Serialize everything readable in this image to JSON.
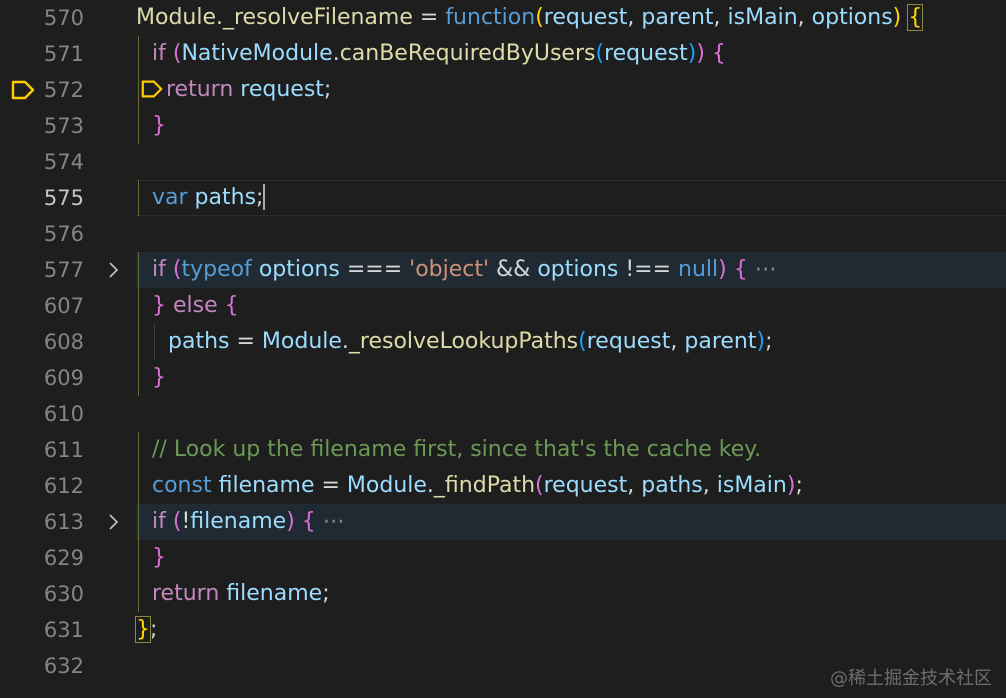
{
  "editor": {
    "lines": [
      {
        "num": "570",
        "tokens": [
          [
            "fn",
            "Module._resolveFilename"
          ],
          [
            "op",
            " = "
          ],
          [
            "kw2",
            "function"
          ],
          [
            "b1",
            "("
          ],
          [
            "var",
            "request"
          ],
          [
            "op",
            ", "
          ],
          [
            "var",
            "parent"
          ],
          [
            "op",
            ", "
          ],
          [
            "var",
            "isMain"
          ],
          [
            "op",
            ", "
          ],
          [
            "var",
            "options"
          ],
          [
            "b1",
            ")"
          ],
          [
            "op",
            " "
          ],
          [
            "b1",
            "{"
          ]
        ]
      },
      {
        "num": "571",
        "tokens": [
          [
            "kw",
            "if"
          ],
          [
            "op",
            " "
          ],
          [
            "b2",
            "("
          ],
          [
            "var",
            "NativeModule"
          ],
          [
            "op",
            "."
          ],
          [
            "fn",
            "canBeRequiredByUsers"
          ],
          [
            "b3",
            "("
          ],
          [
            "var",
            "request"
          ],
          [
            "b3",
            ")"
          ],
          [
            "b2",
            ")"
          ],
          [
            "op",
            " "
          ],
          [
            "b2",
            "{"
          ]
        ]
      },
      {
        "num": "572",
        "tokens": [
          [
            "kw",
            "return"
          ],
          [
            "op",
            " "
          ],
          [
            "var",
            "request"
          ],
          [
            "op",
            ";"
          ]
        ]
      },
      {
        "num": "573",
        "tokens": [
          [
            "b2",
            "}"
          ]
        ]
      },
      {
        "num": "574",
        "tokens": []
      },
      {
        "num": "575",
        "tokens": [
          [
            "kw2",
            "var"
          ],
          [
            "op",
            " "
          ],
          [
            "var",
            "paths"
          ],
          [
            "op",
            ";"
          ]
        ]
      },
      {
        "num": "576",
        "tokens": []
      },
      {
        "num": "577",
        "tokens": [
          [
            "kw",
            "if"
          ],
          [
            "op",
            " "
          ],
          [
            "b2",
            "("
          ],
          [
            "kw2",
            "typeof"
          ],
          [
            "op",
            " "
          ],
          [
            "var",
            "options"
          ],
          [
            "op",
            " === "
          ],
          [
            "str",
            "'object'"
          ],
          [
            "op",
            " && "
          ],
          [
            "var",
            "options"
          ],
          [
            "op",
            " !== "
          ],
          [
            "kw2",
            "null"
          ],
          [
            "b2",
            ")"
          ],
          [
            "op",
            " "
          ],
          [
            "b2",
            "{"
          ],
          [
            "ell",
            " ⋯"
          ]
        ]
      },
      {
        "num": "607",
        "tokens": [
          [
            "b2",
            "}"
          ],
          [
            "op",
            " "
          ],
          [
            "kw",
            "else"
          ],
          [
            "op",
            " "
          ],
          [
            "b2",
            "{"
          ]
        ]
      },
      {
        "num": "608",
        "tokens": [
          [
            "var",
            "paths"
          ],
          [
            "op",
            " = "
          ],
          [
            "var",
            "Module"
          ],
          [
            "op",
            "."
          ],
          [
            "fn",
            "_resolveLookupPaths"
          ],
          [
            "b3",
            "("
          ],
          [
            "var",
            "request"
          ],
          [
            "op",
            ", "
          ],
          [
            "var",
            "parent"
          ],
          [
            "b3",
            ")"
          ],
          [
            "op",
            ";"
          ]
        ]
      },
      {
        "num": "609",
        "tokens": [
          [
            "b2",
            "}"
          ]
        ]
      },
      {
        "num": "610",
        "tokens": []
      },
      {
        "num": "611",
        "tokens": [
          [
            "cm",
            "// Look up the filename first, since that's the cache key."
          ]
        ]
      },
      {
        "num": "612",
        "tokens": [
          [
            "kw2",
            "const"
          ],
          [
            "op",
            " "
          ],
          [
            "var",
            "filename"
          ],
          [
            "op",
            " = "
          ],
          [
            "var",
            "Module"
          ],
          [
            "op",
            "."
          ],
          [
            "fn",
            "_findPath"
          ],
          [
            "b2",
            "("
          ],
          [
            "var",
            "request"
          ],
          [
            "op",
            ", "
          ],
          [
            "var",
            "paths"
          ],
          [
            "op",
            ", "
          ],
          [
            "var",
            "isMain"
          ],
          [
            "b2",
            ")"
          ],
          [
            "op",
            ";"
          ]
        ]
      },
      {
        "num": "613",
        "tokens": [
          [
            "kw",
            "if"
          ],
          [
            "op",
            " "
          ],
          [
            "b2",
            "("
          ],
          [
            "op",
            "!"
          ],
          [
            "var",
            "filename"
          ],
          [
            "b2",
            ")"
          ],
          [
            "op",
            " "
          ],
          [
            "b2",
            "{"
          ],
          [
            "ell",
            " ⋯"
          ]
        ]
      },
      {
        "num": "629",
        "tokens": [
          [
            "b2",
            "}"
          ]
        ]
      },
      {
        "num": "630",
        "tokens": [
          [
            "kw",
            "return"
          ],
          [
            "op",
            " "
          ],
          [
            "var",
            "filename"
          ],
          [
            "op",
            ";"
          ]
        ]
      },
      {
        "num": "631",
        "tokens": [
          [
            "b1",
            "}"
          ],
          [
            "op",
            ";"
          ]
        ]
      },
      {
        "num": "632",
        "tokens": []
      }
    ],
    "active_line": "575",
    "breakpoint_line": "572",
    "folded_lines": [
      "577",
      "613"
    ],
    "colors": {
      "background": "#1e1e1e",
      "breakpoint_highlight": "#4b4a1f",
      "breakpoint_icon": "#ffcc00"
    }
  },
  "watermark": "@稀土掘金技术社区"
}
